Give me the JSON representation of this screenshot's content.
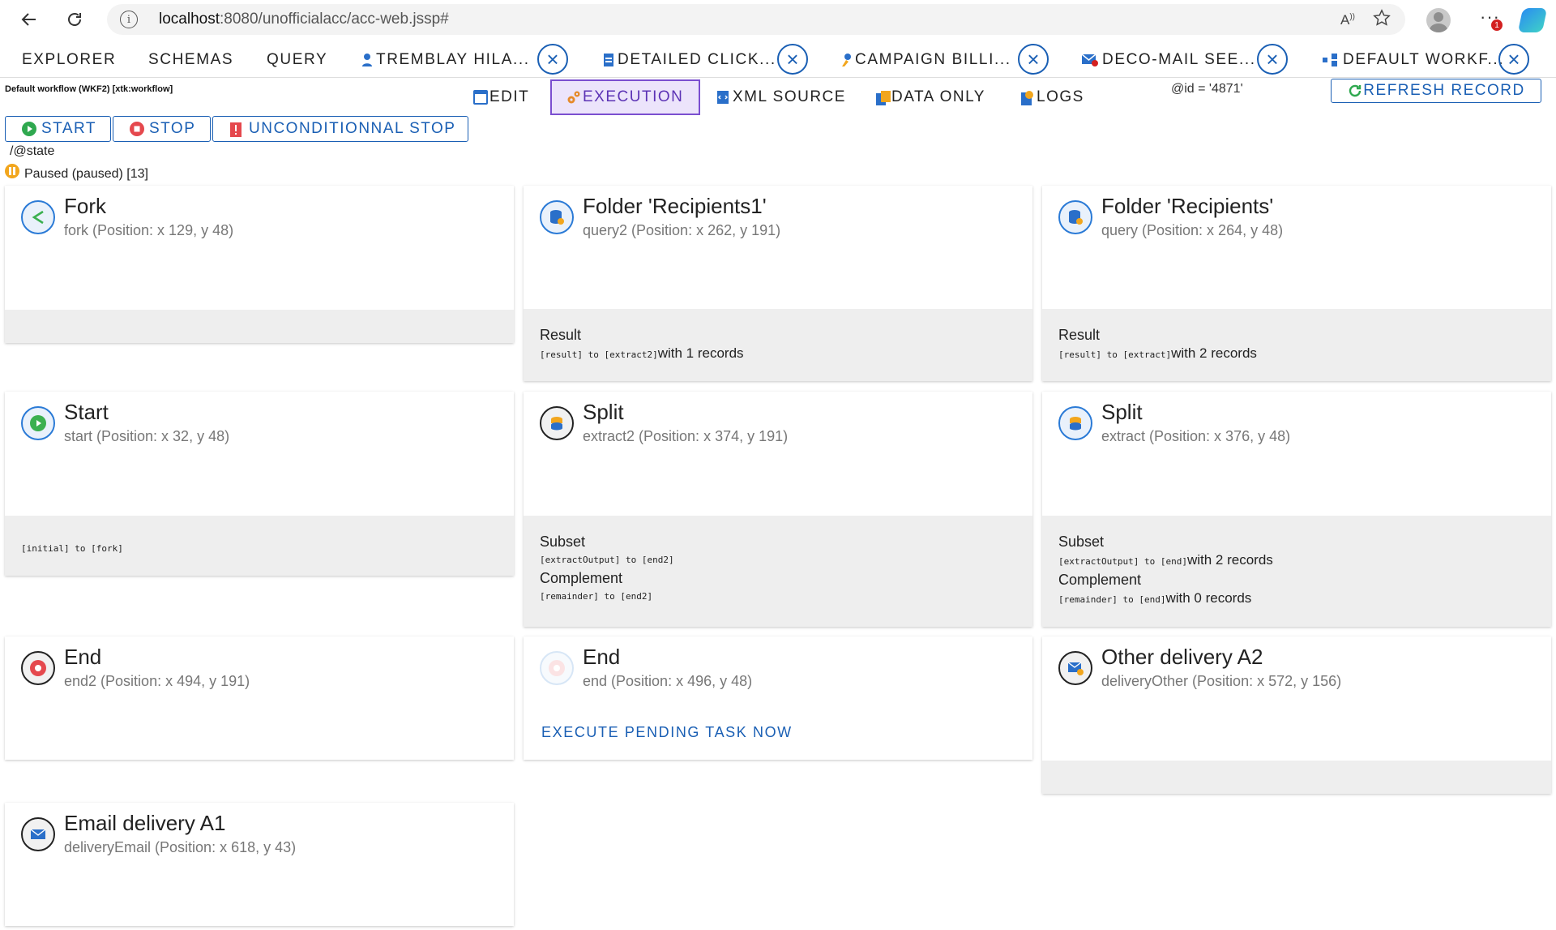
{
  "browser": {
    "url_host": "localhost",
    "url_path": ":8080/unofficialacc/acc-web.jssp#",
    "more_badge": "1"
  },
  "main_tabs": [
    {
      "label": "EXPLORER"
    },
    {
      "label": "SCHEMAS"
    },
    {
      "label": "QUERY"
    },
    {
      "label": "TREMBLAY HILA..."
    },
    {
      "label": "DETAILED CLICK..."
    },
    {
      "label": "CAMPAIGN BILLI..."
    },
    {
      "label": "DECO-MAIL SEE..."
    },
    {
      "label": "DEFAULT WORKF..."
    }
  ],
  "record": {
    "title": "Default workflow (WKF2) [xtk:workflow]",
    "id": "@id = '4871'"
  },
  "sub_tabs": {
    "edit": "EDIT",
    "execution": "EXECUTION",
    "xml": "XML SOURCE",
    "data_only": "DATA ONLY",
    "logs": "LOGS"
  },
  "refresh_label": "REFRESH RECORD",
  "controls": {
    "start": "START",
    "stop": "STOP",
    "unconditional": "UNCONDITIONNAL STOP"
  },
  "state": {
    "path": "/@state",
    "status": "Paused (paused) [13]"
  },
  "cards": [
    {
      "title": "Fork",
      "sub": "fork (Position: x 129, y 48)"
    },
    {
      "title": "Folder 'Recipients1'",
      "sub": "query2 (Position: x 262, y 191)",
      "result_label": "Result",
      "result_transition": "[result] to [extract2]",
      "result_count": "with 1 records"
    },
    {
      "title": "Folder 'Recipients'",
      "sub": "query (Position: x 264, y 48)",
      "result_label": "Result",
      "result_transition": "[result] to [extract]",
      "result_count": "with 2 records"
    },
    {
      "title": "Start",
      "sub": "start (Position: x 32, y 48)",
      "transition": "[initial] to [fork]"
    },
    {
      "title": "Split",
      "sub": "extract2 (Position: x 374, y 191)",
      "subset_label": "Subset",
      "subset_transition": "[extractOutput] to [end2]",
      "complement_label": "Complement",
      "complement_transition": "[remainder] to [end2]"
    },
    {
      "title": "Split",
      "sub": "extract (Position: x 376, y 48)",
      "subset_label": "Subset",
      "subset_transition": "[extractOutput] to [end]",
      "subset_count": "with 2 records",
      "complement_label": "Complement",
      "complement_transition": "[remainder] to [end]",
      "complement_count": "with 0 records"
    },
    {
      "title": "End",
      "sub": "end2 (Position: x 494, y 191)"
    },
    {
      "title": "End",
      "sub": "end (Position: x 496, y 48)",
      "action": "EXECUTE PENDING TASK NOW"
    },
    {
      "title": "Other delivery A2",
      "sub": "deliveryOther (Position: x 572, y 156)"
    },
    {
      "title": "Email delivery A1",
      "sub": "deliveryEmail (Position: x 618, y 43)"
    }
  ]
}
